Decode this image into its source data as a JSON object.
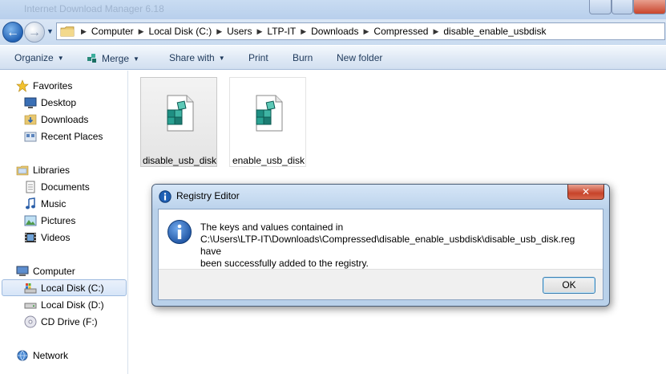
{
  "window": {
    "title": "Internet Download Manager 6.18"
  },
  "address_bar": {
    "crumbs": [
      "Computer",
      "Local Disk (C:)",
      "Users",
      "LTP-IT",
      "Downloads",
      "Compressed",
      "disable_enable_usbdisk"
    ]
  },
  "toolbar": {
    "organize": "Organize",
    "merge": "Merge",
    "share_with": "Share with",
    "print": "Print",
    "burn": "Burn",
    "new_folder": "New folder"
  },
  "nav_pane": {
    "favorites": {
      "label": "Favorites",
      "items": [
        "Desktop",
        "Downloads",
        "Recent Places"
      ]
    },
    "libraries": {
      "label": "Libraries",
      "items": [
        "Documents",
        "Music",
        "Pictures",
        "Videos"
      ]
    },
    "computer": {
      "label": "Computer",
      "items": [
        "Local Disk (C:)",
        "Local Disk (D:)",
        "CD Drive (F:)"
      ],
      "selected": "Local Disk (C:)"
    },
    "network": {
      "label": "Network"
    }
  },
  "files": [
    {
      "name": "disable_usb_disk",
      "icon": "registry-file-icon",
      "highlighted": true
    },
    {
      "name": "enable_usb_disk",
      "icon": "registry-file-icon",
      "highlighted": false
    }
  ],
  "dialog": {
    "title": "Registry Editor",
    "message_line1": "The keys and values contained in",
    "message_line2": "C:\\Users\\LTP-IT\\Downloads\\Compressed\\disable_enable_usbdisk\\disable_usb_disk.reg have",
    "message_line3": "been successfully added to the registry.",
    "ok_label": "OK",
    "close_glyph": "✕"
  },
  "colors": {
    "info_blue": "#1e5fb4",
    "selection_blue": "#d6e5f8",
    "close_red": "#c7432a"
  }
}
